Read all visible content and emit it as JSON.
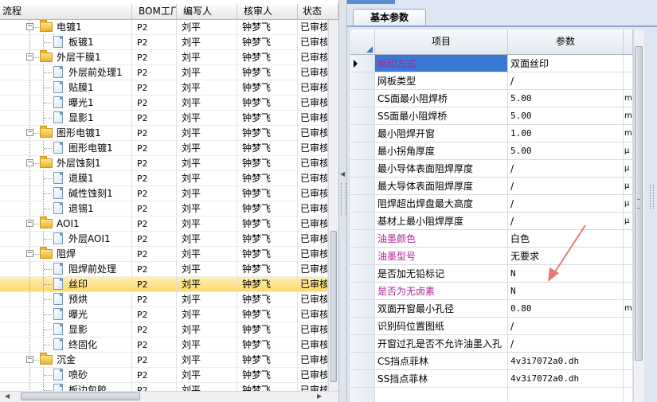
{
  "left_header": {
    "flow": "流程",
    "bom": "BOM工厂",
    "writer": "编写人",
    "reviewer": "核审人",
    "status": "状态"
  },
  "tree_rows": [
    {
      "name": "电镀1",
      "level": 0,
      "kind": "folder",
      "bom": "P2",
      "writer": "刘平",
      "reviewer": "钟梦飞",
      "status": "已审核"
    },
    {
      "name": "板镀1",
      "level": 1,
      "kind": "doc",
      "bom": "P2",
      "writer": "刘平",
      "reviewer": "钟梦飞",
      "status": "已审核"
    },
    {
      "name": "外层干膜1",
      "level": 0,
      "kind": "folder",
      "bom": "P2",
      "writer": "刘平",
      "reviewer": "钟梦飞",
      "status": "已审核"
    },
    {
      "name": "外层前处理1",
      "level": 1,
      "kind": "doc",
      "bom": "P2",
      "writer": "刘平",
      "reviewer": "钟梦飞",
      "status": "已审核"
    },
    {
      "name": "贴膜1",
      "level": 1,
      "kind": "doc",
      "bom": "P2",
      "writer": "刘平",
      "reviewer": "钟梦飞",
      "status": "已审核"
    },
    {
      "name": "曝光1",
      "level": 1,
      "kind": "doc",
      "bom": "P2",
      "writer": "刘平",
      "reviewer": "钟梦飞",
      "status": "已审核"
    },
    {
      "name": "显影1",
      "level": 1,
      "kind": "doc",
      "bom": "P2",
      "writer": "刘平",
      "reviewer": "钟梦飞",
      "status": "已审核"
    },
    {
      "name": "图形电镀1",
      "level": 0,
      "kind": "folder",
      "bom": "P2",
      "writer": "刘平",
      "reviewer": "钟梦飞",
      "status": "已审核"
    },
    {
      "name": "图形电镀1",
      "level": 1,
      "kind": "doc",
      "bom": "P2",
      "writer": "刘平",
      "reviewer": "钟梦飞",
      "status": "已审核"
    },
    {
      "name": "外层蚀刻1",
      "level": 0,
      "kind": "folder",
      "bom": "P2",
      "writer": "刘平",
      "reviewer": "钟梦飞",
      "status": "已审核"
    },
    {
      "name": "退膜1",
      "level": 1,
      "kind": "doc",
      "bom": "P2",
      "writer": "刘平",
      "reviewer": "钟梦飞",
      "status": "已审核"
    },
    {
      "name": "碱性蚀刻1",
      "level": 1,
      "kind": "doc",
      "bom": "P2",
      "writer": "刘平",
      "reviewer": "钟梦飞",
      "status": "已审核"
    },
    {
      "name": "退锡1",
      "level": 1,
      "kind": "doc",
      "bom": "P2",
      "writer": "刘平",
      "reviewer": "钟梦飞",
      "status": "已审核"
    },
    {
      "name": "AOI1",
      "level": 0,
      "kind": "folder",
      "bom": "P2",
      "writer": "刘平",
      "reviewer": "钟梦飞",
      "status": "已审核"
    },
    {
      "name": "外层AOI1",
      "level": 1,
      "kind": "doc",
      "bom": "P2",
      "writer": "刘平",
      "reviewer": "钟梦飞",
      "status": "已审核"
    },
    {
      "name": "阻焊",
      "level": 0,
      "kind": "folder",
      "bom": "P2",
      "writer": "刘平",
      "reviewer": "钟梦飞",
      "status": "已审核"
    },
    {
      "name": "阻焊前处理",
      "level": 1,
      "kind": "doc",
      "bom": "P2",
      "writer": "刘平",
      "reviewer": "钟梦飞",
      "status": "已审核"
    },
    {
      "name": "丝印",
      "level": 1,
      "kind": "doc",
      "bom": "P2",
      "writer": "刘平",
      "reviewer": "钟梦飞",
      "status": "已审核",
      "selected": true
    },
    {
      "name": "预烘",
      "level": 1,
      "kind": "doc",
      "bom": "P2",
      "writer": "刘平",
      "reviewer": "钟梦飞",
      "status": "已审核"
    },
    {
      "name": "曝光",
      "level": 1,
      "kind": "doc",
      "bom": "P2",
      "writer": "刘平",
      "reviewer": "钟梦飞",
      "status": "已审核"
    },
    {
      "name": "显影",
      "level": 1,
      "kind": "doc",
      "bom": "P2",
      "writer": "刘平",
      "reviewer": "钟梦飞",
      "status": "已审核"
    },
    {
      "name": "终固化",
      "level": 1,
      "kind": "doc",
      "bom": "P2",
      "writer": "刘平",
      "reviewer": "钟梦飞",
      "status": "已审核"
    },
    {
      "name": "沉金",
      "level": 0,
      "kind": "folder",
      "bom": "P2",
      "writer": "刘平",
      "reviewer": "钟梦飞",
      "status": "已审核"
    },
    {
      "name": "喷砂",
      "level": 1,
      "kind": "doc",
      "bom": "P2",
      "writer": "刘平",
      "reviewer": "钟梦飞",
      "status": "已审核"
    },
    {
      "name": "板边包胶",
      "level": 1,
      "kind": "doc",
      "bom": "P2",
      "writer": "刘平",
      "reviewer": "钟梦飞",
      "status": "已审核"
    }
  ],
  "right": {
    "tab_label": "基本参数",
    "header": {
      "item": "项目",
      "param": "参数"
    },
    "rows": [
      {
        "item": "丝印方式",
        "value": "双面丝印",
        "unit": "",
        "pink": true,
        "current": true
      },
      {
        "item": "网板类型",
        "value": "/",
        "unit": ""
      },
      {
        "item": "CS面最小阻焊桥",
        "value": "5.00",
        "unit": "mi",
        "mono": true
      },
      {
        "item": "SS面最小阻焊桥",
        "value": "5.00",
        "unit": "mi",
        "mono": true
      },
      {
        "item": "最小阻焊开窗",
        "value": "1.00",
        "unit": "mi",
        "mono": true
      },
      {
        "item": "最小拐角厚度",
        "value": "5.00",
        "unit": "μ",
        "mono": true
      },
      {
        "item": "最小导体表面阻焊厚度",
        "value": "/",
        "unit": "μ"
      },
      {
        "item": "最大导体表面阻焊厚度",
        "value": "/",
        "unit": "μ"
      },
      {
        "item": "阻焊超出焊盘最大高度",
        "value": "/",
        "unit": "μ"
      },
      {
        "item": "基材上最小阻焊厚度",
        "value": "/",
        "unit": "μ"
      },
      {
        "item": "油墨颜色",
        "value": "白色",
        "unit": "",
        "pink": true
      },
      {
        "item": "油墨型号",
        "value": "无要求",
        "unit": "",
        "pink": true
      },
      {
        "item": "是否加无铅标记",
        "value": "N",
        "unit": "",
        "mono": true
      },
      {
        "item": "是否为无卤素",
        "value": "N",
        "unit": "",
        "pink": true,
        "mono": true
      },
      {
        "item": "双面开窗最小孔径",
        "value": "0.80",
        "unit": "mm",
        "mono": true
      },
      {
        "item": "识别码位置图纸",
        "value": "/",
        "unit": ""
      },
      {
        "item": "开窗过孔是否不允许油墨入孔",
        "value": "/",
        "unit": ""
      },
      {
        "item": "CS挡点菲林",
        "value": "4v3i7072a0.dh",
        "unit": "",
        "mono": true
      },
      {
        "item": "SS挡点菲林",
        "value": "4v3i7072a0.dh",
        "unit": "",
        "mono": true
      },
      {
        "item": "",
        "value": "",
        "unit": ""
      }
    ]
  },
  "colors": {
    "selected_row": "#fbd86a",
    "pink_text": "#b0239a",
    "current_cell": "#3a78d4",
    "annotation_arrow": "#e87878"
  },
  "icons": {
    "folder": "folder-icon",
    "document": "document-icon",
    "expand": "expander-icon"
  }
}
